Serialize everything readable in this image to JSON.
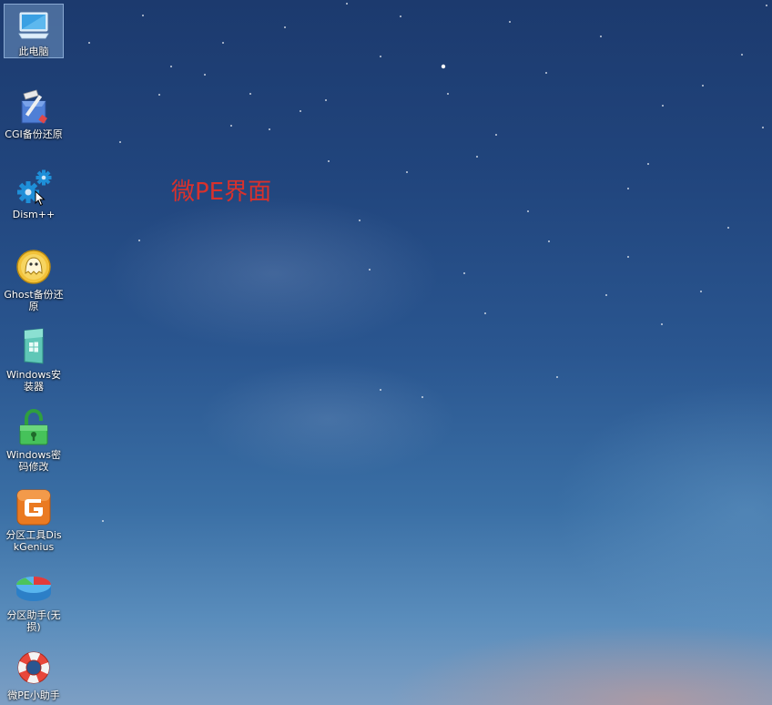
{
  "desktop": {
    "overlay_title": "微PE界面",
    "icons": [
      {
        "label": "此电脑",
        "icon": "computer-icon",
        "selected": true
      },
      {
        "label": "CGI备份还原",
        "icon": "cgi-backup-icon"
      },
      {
        "label": "Dism++",
        "icon": "gears-icon"
      },
      {
        "label": "Ghost备份还原",
        "icon": "ghost-icon"
      },
      {
        "label": "Windows安装器",
        "icon": "windows-installer-icon"
      },
      {
        "label": "Windows密码修改",
        "icon": "padlock-icon"
      },
      {
        "label": "分区工具DiskGenius",
        "icon": "diskgenius-icon"
      },
      {
        "label": "分区助手(无损)",
        "icon": "partition-assistant-icon"
      },
      {
        "label": "微PE小助手",
        "icon": "lifebuoy-icon"
      }
    ]
  },
  "colors": {
    "overlay_text": "#d9312c",
    "selection": "#a0c8f0"
  }
}
